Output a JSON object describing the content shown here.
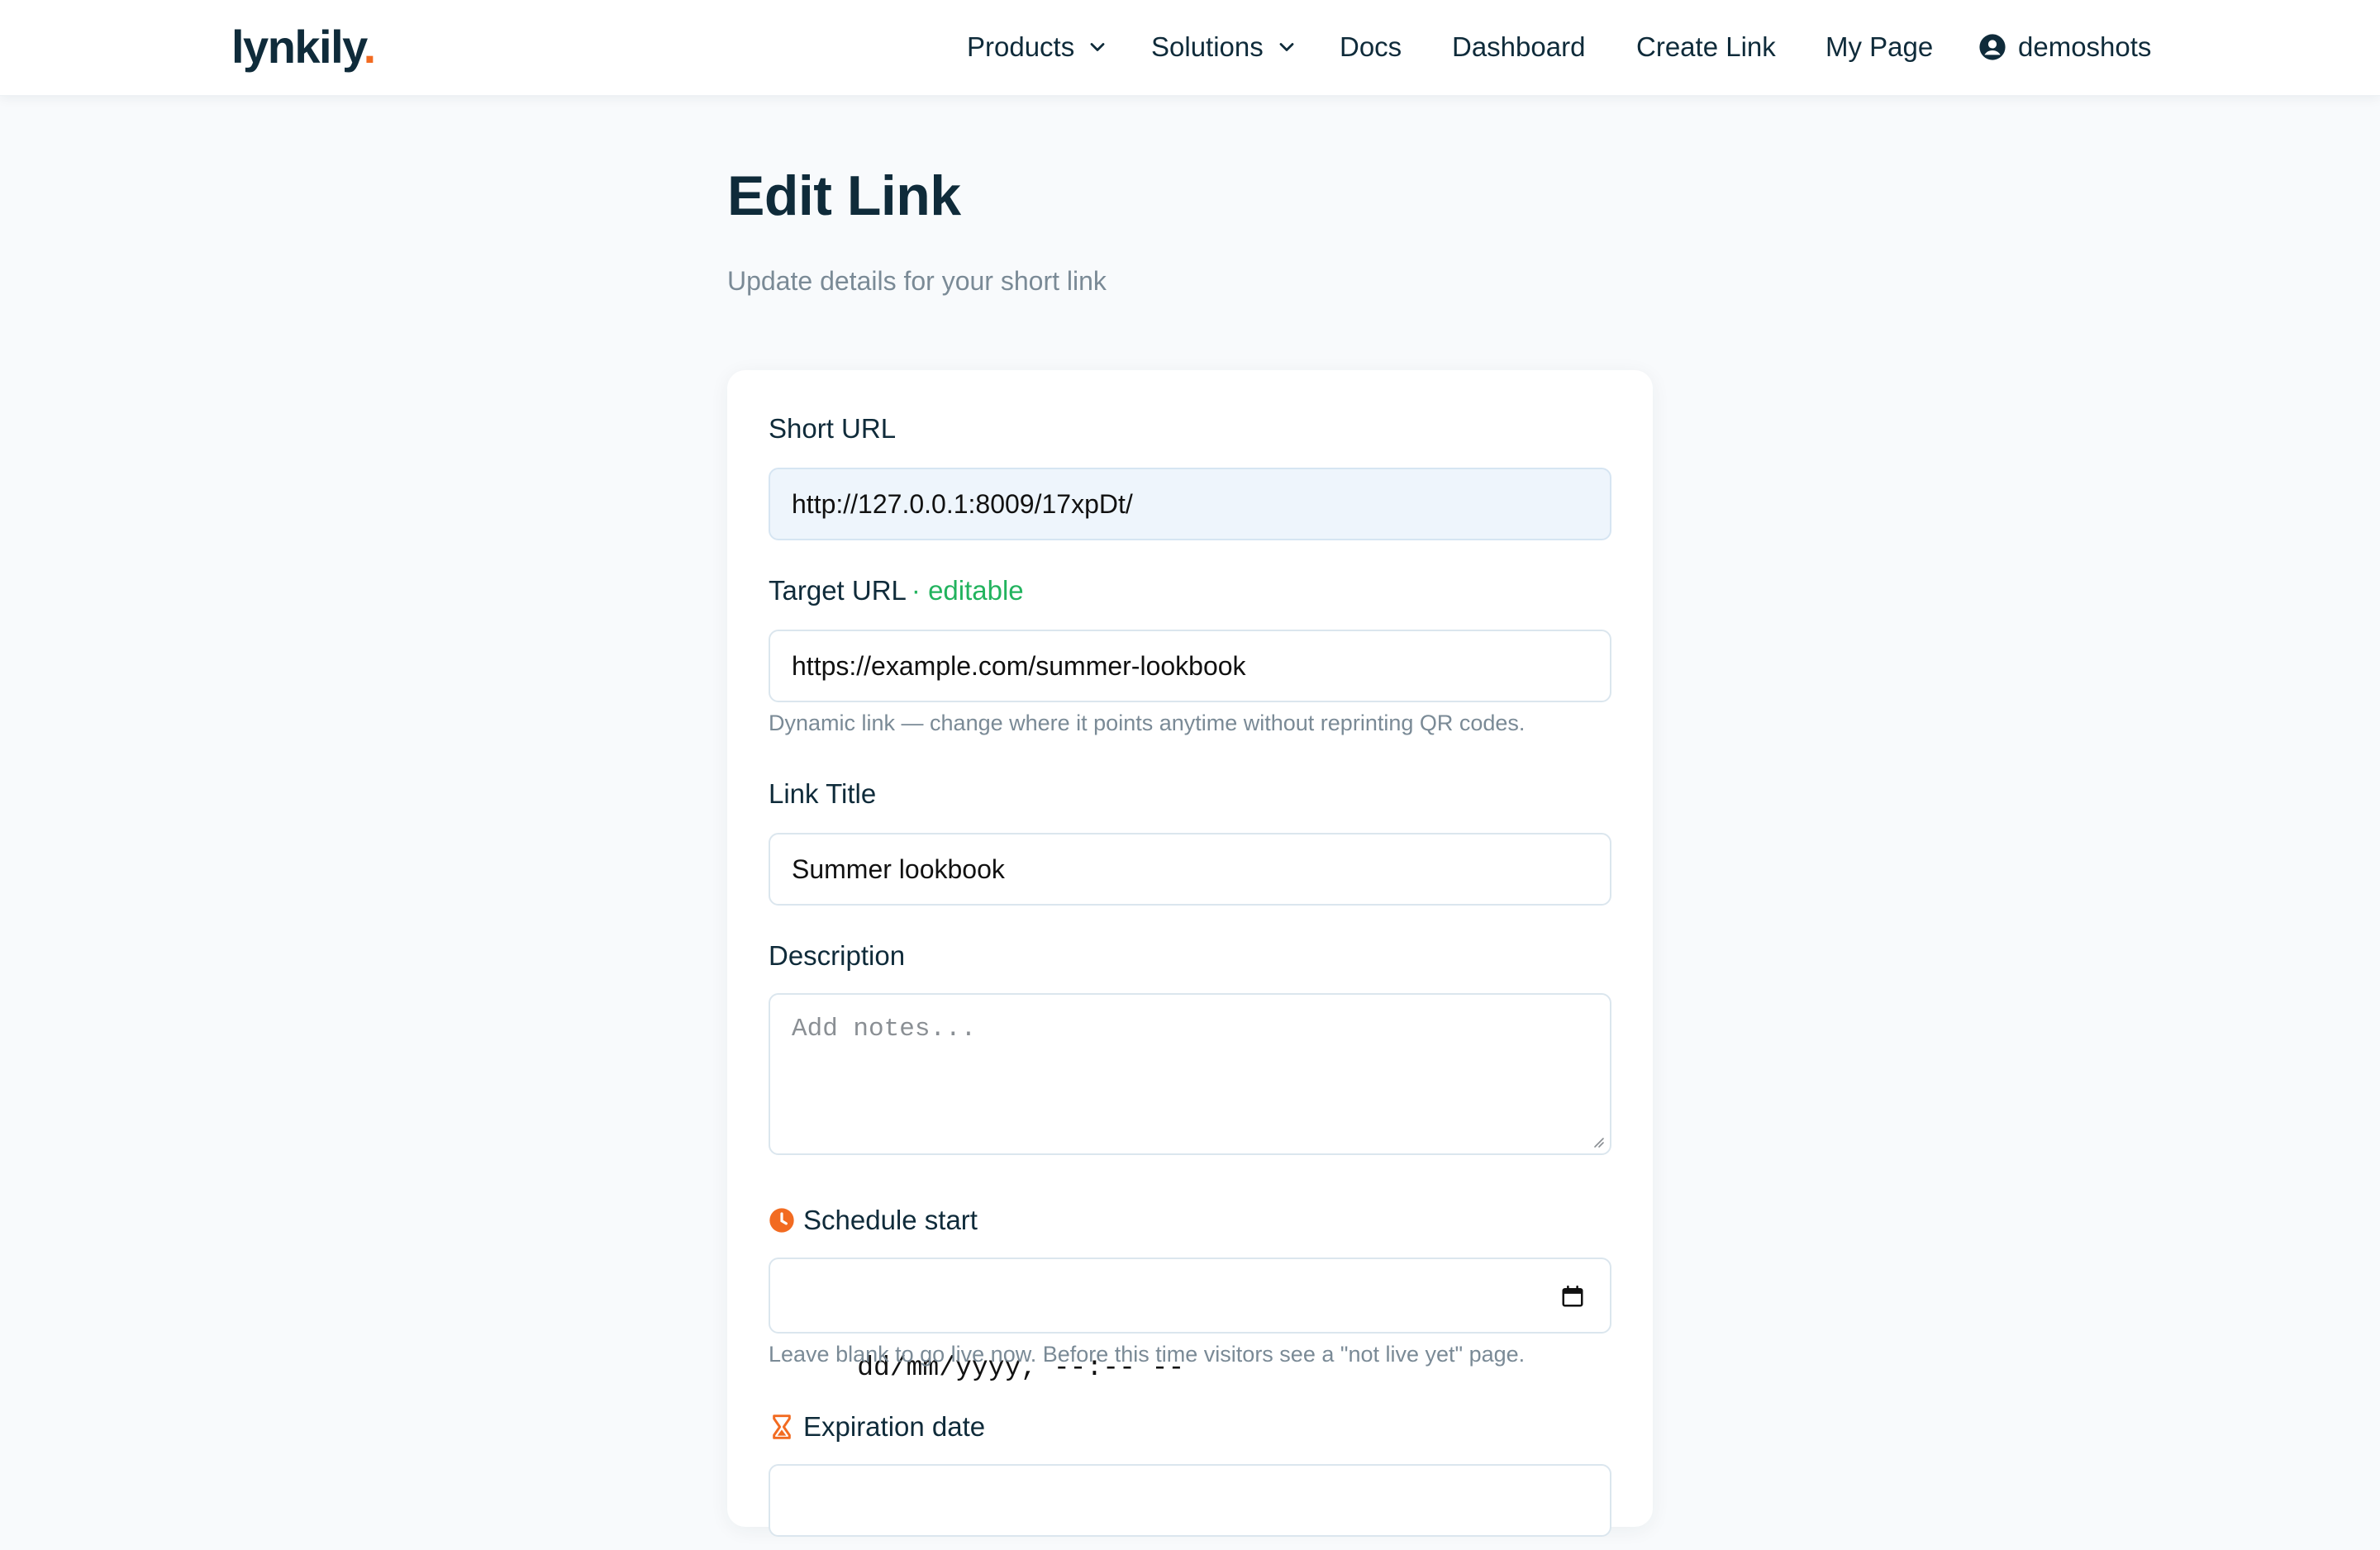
{
  "header": {
    "logo_text": "lynkily",
    "logo_dot": ".",
    "nav": {
      "products": "Products",
      "solutions": "Solutions",
      "docs": "Docs",
      "dashboard": "Dashboard",
      "create_link": "Create Link",
      "my_page": "My Page",
      "user": "demoshots"
    }
  },
  "page": {
    "title": "Edit Link",
    "subtitle": "Update details for your short link"
  },
  "form": {
    "short_url": {
      "label": "Short URL",
      "value": "http://127.0.0.1:8009/17xpDt/"
    },
    "target_url": {
      "label": "Target URL",
      "badge": "· editable",
      "value": "https://example.com/summer-lookbook",
      "help": "Dynamic link — change where it points anytime without reprinting QR codes."
    },
    "link_title": {
      "label": "Link Title",
      "value": "Summer lookbook"
    },
    "description": {
      "label": "Description",
      "placeholder": "Add notes..."
    },
    "schedule_start": {
      "label": "Schedule start",
      "value": "dd/mm/yyyy, --:-- --",
      "help": "Leave blank to go live now. Before this time visitors see a \"not live yet\" page."
    },
    "expiration": {
      "label": "Expiration date"
    }
  },
  "colors": {
    "brand_dark": "#0f2b3a",
    "accent_orange": "#f26b21",
    "editable_green": "#22b35e"
  }
}
